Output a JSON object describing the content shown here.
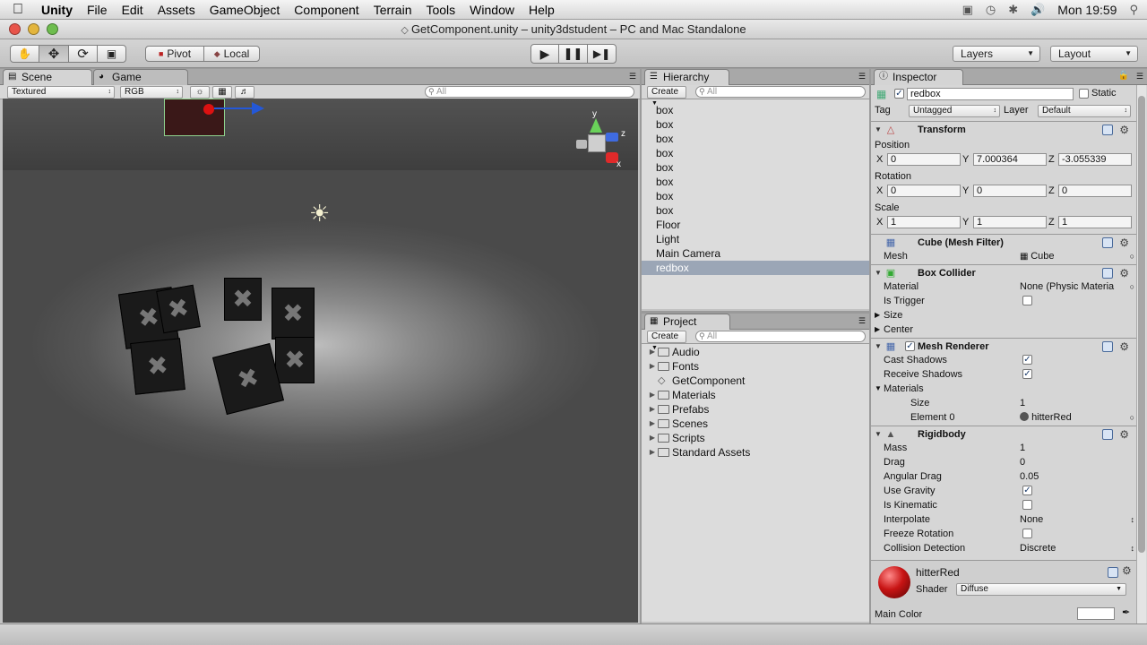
{
  "menubar": {
    "apple": "",
    "app": "Unity",
    "items": [
      "File",
      "Edit",
      "Assets",
      "GameObject",
      "Component",
      "Terrain",
      "Tools",
      "Window",
      "Help"
    ],
    "clock": "Mon 19:59"
  },
  "window": {
    "title": "GetComponent.unity – unity3dstudent – PC and Mac Standalone"
  },
  "toolbar": {
    "pivot": "Pivot",
    "local": "Local",
    "layers": "Layers",
    "layout": "Layout"
  },
  "scene": {
    "tab_scene": "Scene",
    "tab_game": "Game",
    "render_mode": "Textured",
    "color_mode": "RGB",
    "search_placeholder": "All",
    "gizmo_axes": [
      "y",
      "z",
      "x"
    ]
  },
  "hierarchy": {
    "tab": "Hierarchy",
    "create": "Create",
    "search_placeholder": "All",
    "items": [
      "box",
      "box",
      "box",
      "box",
      "box",
      "box",
      "box",
      "box",
      "Floor",
      "Light",
      "Main Camera",
      "redbox"
    ],
    "selected_index": 11
  },
  "project": {
    "tab": "Project",
    "create": "Create",
    "search_placeholder": "All",
    "items": [
      {
        "name": "Audio",
        "type": "folder"
      },
      {
        "name": "Fonts",
        "type": "folder"
      },
      {
        "name": "GetComponent",
        "type": "script"
      },
      {
        "name": "Materials",
        "type": "folder"
      },
      {
        "name": "Prefabs",
        "type": "folder"
      },
      {
        "name": "Scenes",
        "type": "folder"
      },
      {
        "name": "Scripts",
        "type": "folder"
      },
      {
        "name": "Standard Assets",
        "type": "folder"
      }
    ]
  },
  "inspector": {
    "tab": "Inspector",
    "object_name": "redbox",
    "static_label": "Static",
    "tag_label": "Tag",
    "tag_value": "Untagged",
    "layer_label": "Layer",
    "layer_value": "Default",
    "transform": {
      "title": "Transform",
      "position_label": "Position",
      "position": {
        "x": "0",
        "y": "7.000364",
        "z": "-3.055339"
      },
      "rotation_label": "Rotation",
      "rotation": {
        "x": "0",
        "y": "0",
        "z": "0"
      },
      "scale_label": "Scale",
      "scale": {
        "x": "1",
        "y": "1",
        "z": "1"
      }
    },
    "mesh_filter": {
      "title": "Cube (Mesh Filter)",
      "mesh_label": "Mesh",
      "mesh_value": "Cube"
    },
    "box_collider": {
      "title": "Box Collider",
      "material_label": "Material",
      "material_value": "None (Physic Materia",
      "trigger_label": "Is Trigger",
      "size_label": "Size",
      "center_label": "Center"
    },
    "mesh_renderer": {
      "title": "Mesh Renderer",
      "cast_label": "Cast Shadows",
      "receive_label": "Receive Shadows",
      "materials_label": "Materials",
      "size_label": "Size",
      "size_value": "1",
      "element_label": "Element 0",
      "element_value": "hitterRed"
    },
    "rigidbody": {
      "title": "Rigidbody",
      "mass_label": "Mass",
      "mass_value": "1",
      "drag_label": "Drag",
      "drag_value": "0",
      "angular_label": "Angular Drag",
      "angular_value": "0.05",
      "gravity_label": "Use Gravity",
      "kinematic_label": "Is Kinematic",
      "interpolate_label": "Interpolate",
      "interpolate_value": "None",
      "freeze_label": "Freeze Rotation",
      "collision_label": "Collision Detection",
      "collision_value": "Discrete"
    },
    "material": {
      "name": "hitterRed",
      "shader_label": "Shader",
      "shader_value": "Diffuse",
      "main_color_label": "Main Color"
    }
  },
  "colors": {
    "selection": "#9ba6b6",
    "accent_red": "#c81414"
  }
}
